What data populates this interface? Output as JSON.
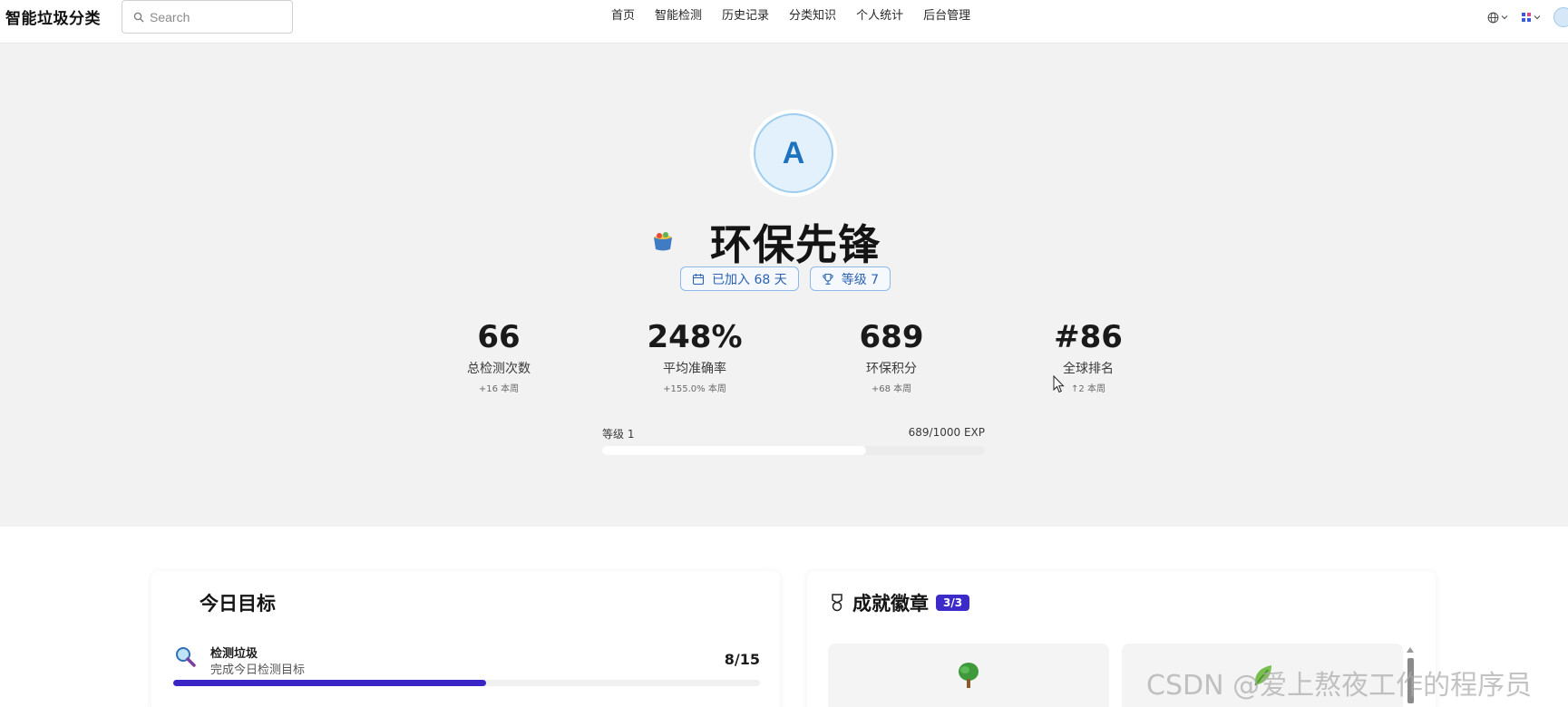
{
  "app": {
    "brand": "智能垃圾分类",
    "search_placeholder": "Search"
  },
  "nav": {
    "items": [
      "首页",
      "智能检测",
      "历史记录",
      "分类知识",
      "个人统计",
      "后台管理"
    ]
  },
  "toolbar": {
    "language_icon": "globe-icon",
    "apps_icon": "grid-icon"
  },
  "profile": {
    "avatar_letter": "A",
    "title": "环保先锋",
    "title_icon": "recycle-bin-emoji",
    "joined_label": "已加入 68 天",
    "level_label": "等级 7"
  },
  "stats": [
    {
      "value": "66",
      "label": "总检测次数",
      "delta": "+16 本周"
    },
    {
      "value": "248%",
      "label": "平均准确率",
      "delta": "+155.0% 本周"
    },
    {
      "value": "689",
      "label": "环保积分",
      "delta": "+68 本周"
    },
    {
      "value": "#86",
      "label": "全球排名",
      "delta": "↑2 本周"
    }
  ],
  "level_progress": {
    "level_text": "等级 1",
    "exp_text": "689/1000 EXP",
    "fraction": 0.689
  },
  "daily_goals": {
    "title": "今日目标",
    "items": [
      {
        "name": "检测垃圾",
        "desc": "完成今日检测目标",
        "count": "8/15",
        "fraction": 0.533
      }
    ]
  },
  "badges": {
    "title": "成就徽章",
    "count": "3/3",
    "items": [
      {
        "icon": "tree-emoji"
      },
      {
        "icon": "leaf-emoji"
      }
    ]
  },
  "watermark": "CSDN @爱上熬夜工作的程序员",
  "colors": {
    "accent": "#3c2bc8",
    "chip_text": "#2b62b3",
    "hero_bg": "#f2f2f2"
  }
}
